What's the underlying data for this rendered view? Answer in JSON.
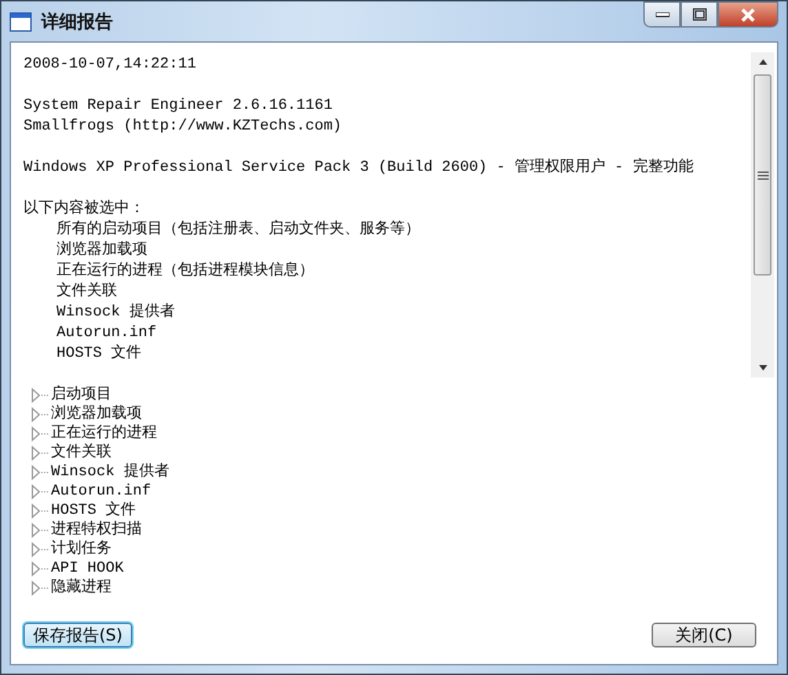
{
  "window": {
    "title": "详细报告"
  },
  "report": [
    {
      "lines": [
        "2008-10-07,14:22:11"
      ]
    },
    {
      "lines": [
        "System Repair Engineer 2.6.16.1161",
        "Smallfrogs (http://www.KZTechs.com)"
      ]
    },
    {
      "lines": [
        "Windows XP Professional Service Pack 3 (Build 2600) - 管理权限用户 - 完整功能"
      ]
    },
    {
      "lines": [
        "以下内容被选中："
      ],
      "items": [
        "所有的启动项目（包括注册表、启动文件夹、服务等）",
        "浏览器加载项",
        "正在运行的进程（包括进程模块信息）",
        "文件关联",
        "Winsock 提供者",
        "Autorun.inf",
        "HOSTS 文件"
      ]
    }
  ],
  "tree": [
    {
      "label": "启动项目",
      "expanded": false
    },
    {
      "label": "浏览器加载项",
      "expanded": false
    },
    {
      "label": "正在运行的进程",
      "expanded": false
    },
    {
      "label": "文件关联",
      "expanded": false
    },
    {
      "label": "Winsock 提供者",
      "expanded": false
    },
    {
      "label": "Autorun.inf",
      "expanded": false
    },
    {
      "label": "HOSTS 文件",
      "expanded": false
    },
    {
      "label": "进程特权扫描",
      "expanded": false
    },
    {
      "label": "计划任务",
      "expanded": false
    },
    {
      "label": "API HOOK",
      "expanded": false
    },
    {
      "label": "隐藏进程",
      "expanded": false
    }
  ],
  "buttons": [
    {
      "label": "保存报告(S)",
      "focused": true
    },
    {
      "label": "关闭(C)",
      "focused": false
    }
  ]
}
